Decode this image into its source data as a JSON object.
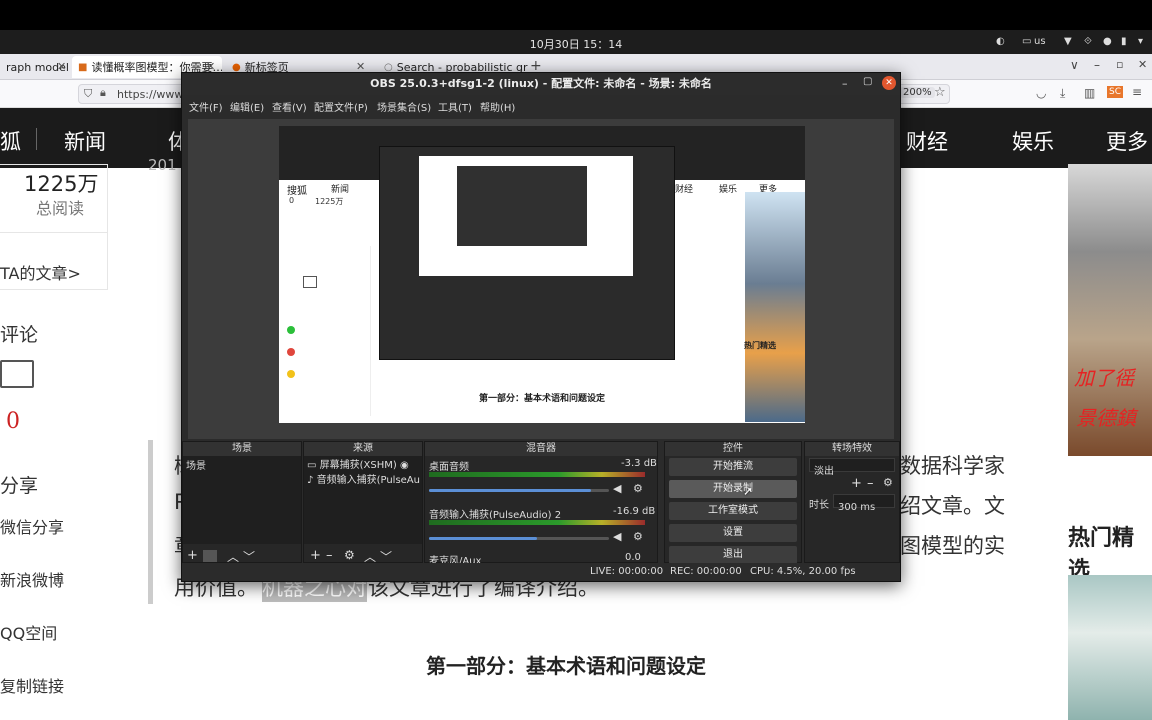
{
  "system": {
    "clock": "10月30日 15：14",
    "keyboard": "us"
  },
  "browser": {
    "tabs": [
      {
        "label": "raph model"
      },
      {
        "label": "读懂概率图模型：你需要…"
      },
      {
        "label": "新标签页"
      },
      {
        "label": "Search - probabilistic gra…"
      }
    ],
    "url": "https://www.s",
    "zoom": "200%"
  },
  "page": {
    "nav": [
      "狐",
      "新闻",
      "体",
      "财经",
      "娱乐",
      "更多"
    ],
    "stats": {
      "count": "1225万",
      "count_label": "总阅读"
    },
    "ta_articles": "TA的文章>",
    "comment_label": "评论",
    "comment_count": "0",
    "share_label": "分享",
    "share_items": [
      "微信分享",
      "新浪微博",
      "QQ空间",
      "复制链接"
    ],
    "body_lines": [
      "概",
      "数据科学家",
      "P",
      "绍文章。文",
      "章",
      "图模型的实",
      "用价值。",
      "机器之心对",
      "该文章进行了编译介绍。"
    ],
    "section_title": "第一部分：基本术语和问题设定",
    "hot_title": "热门精选",
    "ad_text_1": "加了徭",
    "ad_text_2": "景德鎮",
    "year": "201"
  },
  "obs": {
    "title": "OBS 25.0.3+dfsg1-2 (linux) - 配置文件: 未命名 - 场景: 未命名",
    "menu": [
      "文件(F)",
      "编辑(E)",
      "查看(V)",
      "配置文件(P)",
      "场景集合(S)",
      "工具(T)",
      "帮助(H)"
    ],
    "docks": {
      "scenes": {
        "title": "场景",
        "items": [
          "场景"
        ]
      },
      "sources": {
        "title": "来源",
        "items": [
          "屏幕捕获(XSHM)",
          "音频输入捕获(PulseAu"
        ]
      },
      "mixer": {
        "title": "混音器",
        "channels": [
          {
            "name": "桌面音频",
            "db": "-3.3 dB",
            "volume": 0.9
          },
          {
            "name": "音频输入捕获(PulseAudio) 2",
            "db": "-16.9 dB",
            "volume": 0.6
          },
          {
            "name": "麦克风/Aux",
            "db": "0.0 dB",
            "volume": 0.9
          }
        ]
      },
      "controls": {
        "title": "控件",
        "buttons": [
          "开始推流",
          "开始录制",
          "工作室模式",
          "设置",
          "退出"
        ]
      },
      "transitions": {
        "title": "转场特效",
        "selected": "淡出",
        "duration_label": "时长",
        "duration": "300 ms"
      }
    },
    "status": {
      "live": "LIVE: 00:00:00",
      "rec": "REC: 00:00:00",
      "cpu": "CPU: 4.5%, 20.00 fps"
    },
    "preview": {
      "nested_title": "第一部分：基本术语和问题设定",
      "nested_nav": [
        "搜狐",
        "新闻",
        "财经",
        "娱乐",
        "更多"
      ],
      "nested_stats": [
        "0",
        "1225万"
      ],
      "nested_hot": "热门精选"
    }
  },
  "colors": {
    "obs_bg": "#2b2b2b",
    "sohu_nav": "#1b1b1b",
    "close_button": "#e2572f"
  }
}
